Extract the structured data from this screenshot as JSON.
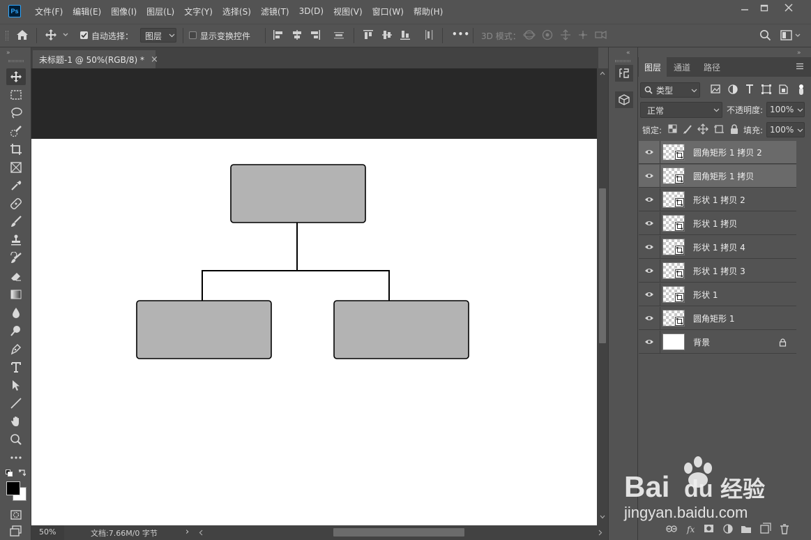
{
  "app": {
    "logo": "Ps"
  },
  "menu": [
    "文件(F)",
    "编辑(E)",
    "图像(I)",
    "图层(L)",
    "文字(Y)",
    "选择(S)",
    "滤镜(T)",
    "3D(D)",
    "视图(V)",
    "窗口(W)",
    "帮助(H)"
  ],
  "options": {
    "auto_select_label": "自动选择：",
    "auto_select_target": "图层",
    "show_transform_label": "显示变换控件",
    "more": "•••",
    "mode3d_label": "3D 模式："
  },
  "document": {
    "tab_title": "未标题-1 @ 50%(RGB/8) *",
    "close_glyph": "×"
  },
  "status": {
    "zoom": "50%",
    "doc_info": "文档:7.66M/0 字节",
    "arrow": "›"
  },
  "panel": {
    "tabs": [
      "图层",
      "通道",
      "路径"
    ],
    "filter_kind": "类型",
    "blend_mode": "正常",
    "opacity_label": "不透明度:",
    "opacity_value": "100%",
    "lock_label": "锁定:",
    "fill_label": "填充:",
    "fill_value": "100%"
  },
  "layers": [
    {
      "name": "圆角矩形 1 拷贝 2",
      "selected": true,
      "thumb": "shape"
    },
    {
      "name": "圆角矩形 1 拷贝",
      "selected": true,
      "thumb": "shape"
    },
    {
      "name": "形状 1 拷贝 2",
      "selected": false,
      "thumb": "shape"
    },
    {
      "name": "形状 1 拷贝",
      "selected": false,
      "thumb": "shape"
    },
    {
      "name": "形状 1 拷贝 4",
      "selected": false,
      "thumb": "shape"
    },
    {
      "name": "形状 1 拷贝 3",
      "selected": false,
      "thumb": "shape"
    },
    {
      "name": "形状 1",
      "selected": false,
      "thumb": "shape"
    },
    {
      "name": "圆角矩形 1",
      "selected": false,
      "thumb": "shape"
    },
    {
      "name": "背景",
      "selected": false,
      "thumb": "white",
      "locked": true
    }
  ],
  "watermark": {
    "brand_left": "Bai",
    "brand_right": "经验",
    "url": "jingyan.baidu.com"
  },
  "colors": {
    "box_fill": "#b3b3b3",
    "pasteboard": "#282828",
    "ui_bg": "#535353",
    "selected_layer": "#6a6a6a"
  }
}
